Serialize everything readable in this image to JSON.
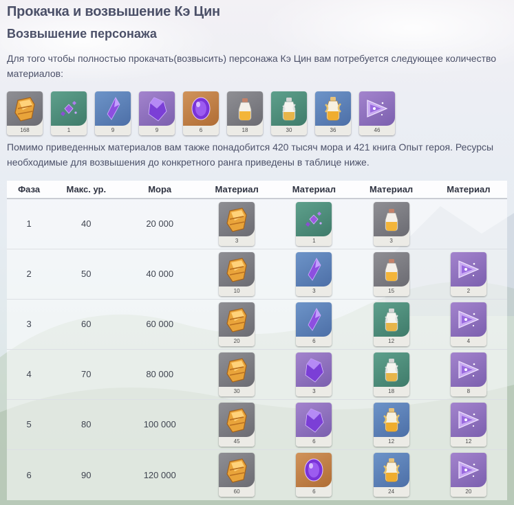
{
  "title": "Прокачка и возвышение Кэ Цин",
  "subtitle": "Возвышение персонажа",
  "intro": "Для того чтобы полностью прокачать(возвысить) персонажа Кэ Цин вам потребуется следующее количество материалов:",
  "totals": [
    {
      "icon": "cor-lapis-icon",
      "count": "168"
    },
    {
      "icon": "vajrada-sliver-icon",
      "count": "1"
    },
    {
      "icon": "vajrada-fragment-icon",
      "count": "9"
    },
    {
      "icon": "vajrada-chunk-icon",
      "count": "9"
    },
    {
      "icon": "vajrada-gemstone-icon",
      "count": "6"
    },
    {
      "icon": "whopperflower-nectar-icon",
      "count": "18"
    },
    {
      "icon": "shimmering-nectar-icon",
      "count": "30"
    },
    {
      "icon": "energy-nectar-icon",
      "count": "36"
    },
    {
      "icon": "lightning-prism-icon",
      "count": "46"
    }
  ],
  "extra_text": "Помимо приведенных материалов вам также понадобится 420 тысяч мора и 421 книга Опыт героя. Ресурсы необходимые для возвышения до конкретного ранга приведены в таблице ниже.",
  "table": {
    "headers": [
      "Фаза",
      "Макс. ур.",
      "Мора",
      "Материал",
      "Материал",
      "Материал",
      "Материал"
    ],
    "rows": [
      {
        "phase": "1",
        "max_level": "40",
        "mora": "20 000",
        "materials": [
          {
            "icon": "cor-lapis-icon",
            "count": "3"
          },
          {
            "icon": "vajrada-sliver-icon",
            "count": "1"
          },
          {
            "icon": "whopperflower-nectar-icon",
            "count": "3"
          }
        ]
      },
      {
        "phase": "2",
        "max_level": "50",
        "mora": "40 000",
        "materials": [
          {
            "icon": "cor-lapis-icon",
            "count": "10"
          },
          {
            "icon": "vajrada-fragment-icon",
            "count": "3"
          },
          {
            "icon": "whopperflower-nectar-icon",
            "count": "15"
          },
          {
            "icon": "lightning-prism-icon",
            "count": "2"
          }
        ]
      },
      {
        "phase": "3",
        "max_level": "60",
        "mora": "60 000",
        "materials": [
          {
            "icon": "cor-lapis-icon",
            "count": "20"
          },
          {
            "icon": "vajrada-fragment-icon",
            "count": "6"
          },
          {
            "icon": "shimmering-nectar-icon",
            "count": "12"
          },
          {
            "icon": "lightning-prism-icon",
            "count": "4"
          }
        ]
      },
      {
        "phase": "4",
        "max_level": "70",
        "mora": "80 000",
        "materials": [
          {
            "icon": "cor-lapis-icon",
            "count": "30"
          },
          {
            "icon": "vajrada-chunk-icon",
            "count": "3"
          },
          {
            "icon": "shimmering-nectar-icon",
            "count": "18"
          },
          {
            "icon": "lightning-prism-icon",
            "count": "8"
          }
        ]
      },
      {
        "phase": "5",
        "max_level": "80",
        "mora": "100 000",
        "materials": [
          {
            "icon": "cor-lapis-icon",
            "count": "45"
          },
          {
            "icon": "vajrada-chunk-icon",
            "count": "6"
          },
          {
            "icon": "energy-nectar-icon",
            "count": "12"
          },
          {
            "icon": "lightning-prism-icon",
            "count": "12"
          }
        ]
      },
      {
        "phase": "6",
        "max_level": "90",
        "mora": "120 000",
        "materials": [
          {
            "icon": "cor-lapis-icon",
            "count": "60"
          },
          {
            "icon": "vajrada-gemstone-icon",
            "count": "6"
          },
          {
            "icon": "energy-nectar-icon",
            "count": "24"
          },
          {
            "icon": "lightning-prism-icon",
            "count": "20"
          }
        ]
      }
    ]
  },
  "rarity_colors": {
    "gray": "#7c7c82",
    "green": "#4f8d7b",
    "blue": "#5d82b8",
    "purple": "#8f72bf",
    "orange": "#c08047"
  }
}
